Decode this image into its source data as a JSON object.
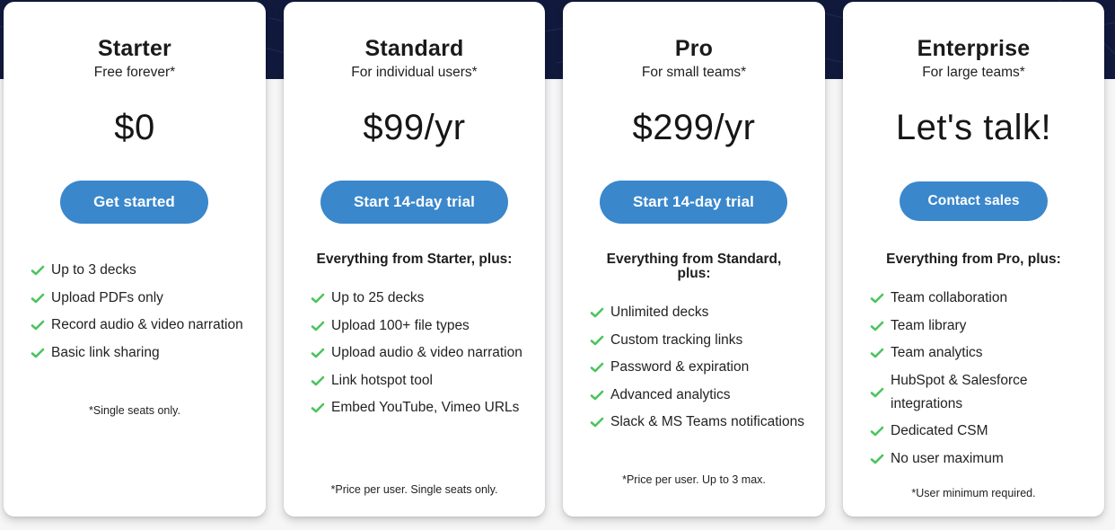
{
  "colors": {
    "hero_background": "#111a3d",
    "page_background": "#f6f6f7",
    "button": "#3a87cc",
    "check": "#4cc45f"
  },
  "plans": [
    {
      "name": "Starter",
      "subtitle": "Free forever*",
      "price": "$0",
      "cta": "Get started",
      "plus_heading": "",
      "features": [
        "Up to 3 decks",
        "Upload PDFs only",
        "Record audio & video narration",
        "Basic link sharing"
      ],
      "note": "*Single seats only."
    },
    {
      "name": "Standard",
      "subtitle": "For individual users*",
      "price": "$99/yr",
      "cta": "Start 14-day trial",
      "plus_heading": "Everything from Starter, plus:",
      "features": [
        "Up to 25 decks",
        "Upload 100+ file types",
        "Upload audio & video narration",
        "Link hotspot tool",
        "Embed YouTube, Vimeo URLs"
      ],
      "note": "*Price per user. Single seats only."
    },
    {
      "name": "Pro",
      "subtitle": "For small teams*",
      "price": "$299/yr",
      "cta": "Start 14-day trial",
      "plus_heading": "Everything from Standard, plus:",
      "features": [
        "Unlimited decks",
        "Custom tracking links",
        "Password & expiration",
        "Advanced analytics",
        "Slack & MS Teams notifications"
      ],
      "note": "*Price per user. Up to 3 max."
    },
    {
      "name": "Enterprise",
      "subtitle": "For large teams*",
      "price": "Let's talk!",
      "cta": "Contact sales",
      "plus_heading": "Everything from Pro, plus:",
      "features": [
        "Team collaboration",
        "Team library",
        "Team analytics",
        "HubSpot & Salesforce integrations",
        "Dedicated CSM",
        "No user maximum"
      ],
      "note": "*User minimum required."
    }
  ]
}
